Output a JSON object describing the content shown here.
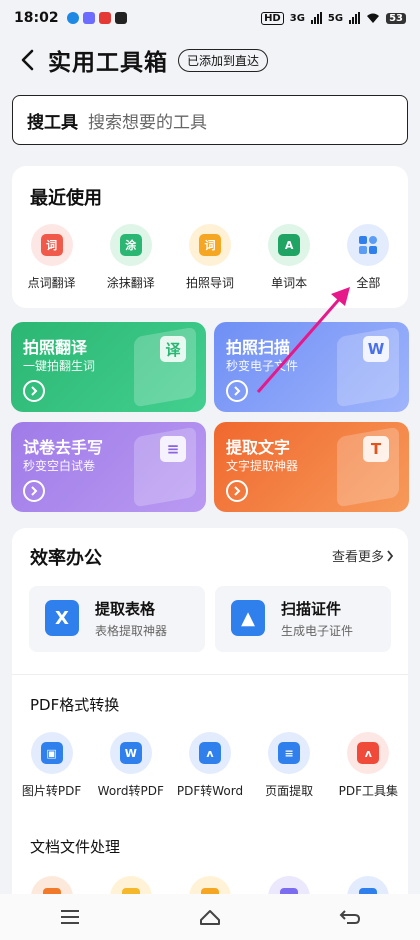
{
  "status": {
    "time": "18:02",
    "net1": "3G",
    "net2": "5G",
    "hd": "HD",
    "battery": "53"
  },
  "header": {
    "title": "实用工具箱",
    "badge": "已添加到直达"
  },
  "search": {
    "label": "搜工具",
    "placeholder": "搜索想要的工具"
  },
  "recent": {
    "title": "最近使用",
    "items": [
      {
        "label": "点词翻译",
        "glyph": "词",
        "icon": "word-translate-icon"
      },
      {
        "label": "涂抹翻译",
        "glyph": "涂",
        "icon": "smear-translate-icon"
      },
      {
        "label": "拍照导词",
        "glyph": "词",
        "icon": "photo-word-icon"
      },
      {
        "label": "单词本",
        "glyph": "A",
        "icon": "wordbook-icon"
      },
      {
        "label": "全部",
        "glyph": "",
        "icon": "grid-icon"
      }
    ]
  },
  "features": [
    {
      "title": "拍照翻译",
      "subtitle": "一键拍翻生词",
      "glyph": "译",
      "color": "#2bb673"
    },
    {
      "title": "拍照扫描",
      "subtitle": "秒变电子文件",
      "glyph": "W",
      "color": "#6f8ff5"
    },
    {
      "title": "试卷去手写",
      "subtitle": "秒变空白试卷",
      "glyph": "≡",
      "color": "#9f7be8"
    },
    {
      "title": "提取文字",
      "subtitle": "文字提取神器",
      "glyph": "T",
      "color": "#f0682e"
    }
  ],
  "office": {
    "title": "效率办公",
    "more": "查看更多",
    "tiles": [
      {
        "title": "提取表格",
        "subtitle": "表格提取神器",
        "glyph": "X"
      },
      {
        "title": "扫描证件",
        "subtitle": "生成电子证件",
        "glyph": "▲"
      }
    ],
    "pdf_title": "PDF格式转换",
    "pdf_items": [
      {
        "label": "图片转PDF",
        "glyph": "▣"
      },
      {
        "label": "Word转PDF",
        "glyph": "W"
      },
      {
        "label": "PDF转Word",
        "glyph": "ᴧ"
      },
      {
        "label": "页面提取",
        "glyph": "≡"
      },
      {
        "label": "PDF工具集",
        "glyph": "ᴧ"
      }
    ],
    "doc_title": "文档文件处理",
    "doc_colors": [
      "#f07a2a",
      "#f5b82a",
      "#f5a623",
      "#7b6cf0",
      "#2f80ed"
    ]
  },
  "colors": {
    "accent_blue": "#2f80ed",
    "arrow": "#e6188a"
  }
}
